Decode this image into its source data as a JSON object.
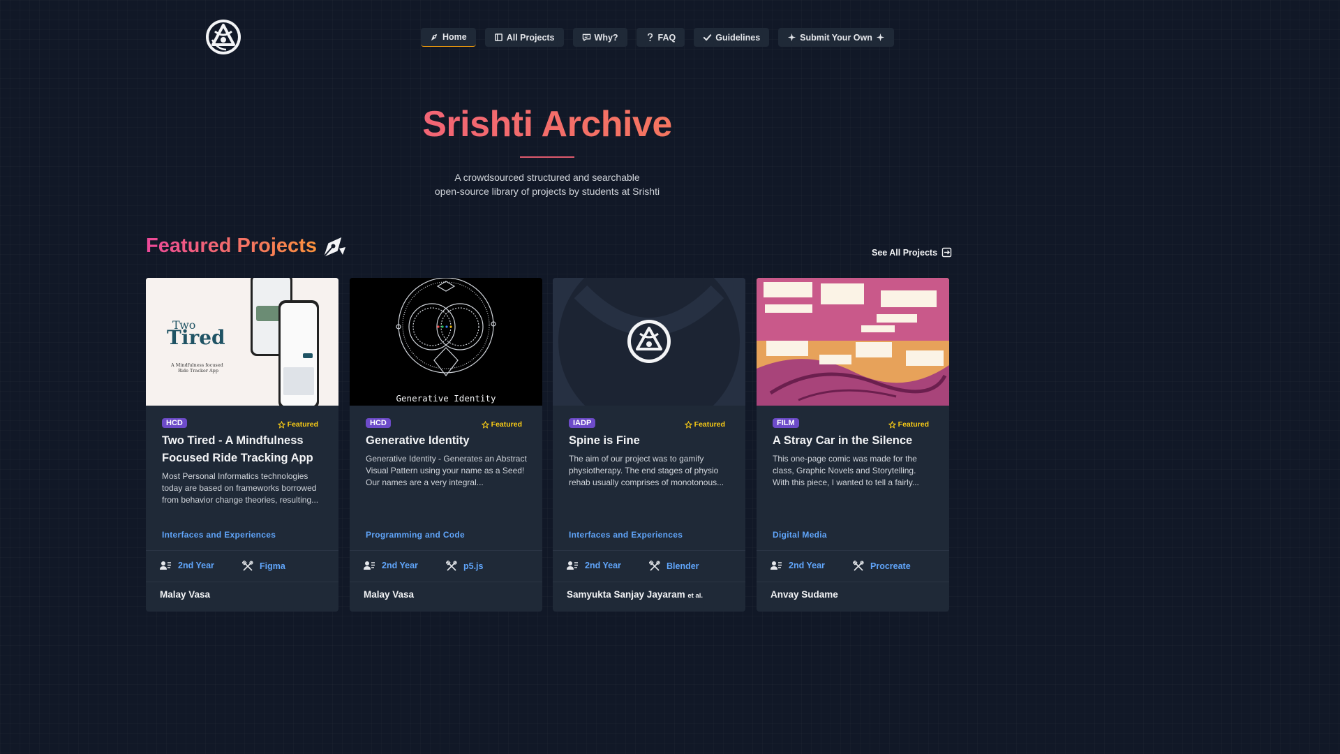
{
  "nav": {
    "items": [
      {
        "label": "Home",
        "icon": "pen-nib-icon"
      },
      {
        "label": "All Projects",
        "icon": "book-icon"
      },
      {
        "label": "Why?",
        "icon": "chat-icon"
      },
      {
        "label": "FAQ",
        "icon": "question-icon"
      },
      {
        "label": "Guidelines",
        "icon": "check-icon"
      },
      {
        "label": "Submit Your Own",
        "icon": "sparkle-icon"
      }
    ]
  },
  "hero": {
    "title": "Srishti Archive",
    "subtitle_line1": "A crowdsourced structured and searchable",
    "subtitle_line2": "open-source library of projects by students at Srishti"
  },
  "featured": {
    "title": "Featured Projects",
    "see_all_label": "See All Projects"
  },
  "cards": [
    {
      "tag": "HCD",
      "featured_label": "Featured",
      "title": "Two Tired - A Mindfulness Focused Ride Tracking App",
      "description": "Most Personal Informatics technologies today are based on frameworks borrowed from behavior change theories, resulting...",
      "category": "Interfaces and Experiences",
      "year": "2nd Year",
      "tool": "Figma",
      "author": "Malay Vasa",
      "author_suffix": "",
      "image_text": {
        "brand_small": "Two",
        "brand_big": "Tired",
        "tagline_1": "A Mindfulness focused",
        "tagline_2": "Ride Tracker App"
      }
    },
    {
      "tag": "HCD",
      "featured_label": "Featured",
      "title": "Generative Identity",
      "description": "Generative Identity - Generates an Abstract Visual Pattern using your name as a Seed! Our names are a very integral...",
      "category": "Programming and Code",
      "year": "2nd Year",
      "tool": "p5.js",
      "author": "Malay Vasa",
      "author_suffix": "",
      "image_text": {
        "caption": "Generative Identity"
      }
    },
    {
      "tag": "IADP",
      "featured_label": "Featured",
      "title": "Spine is Fine",
      "description": "The aim of our project was to gamify physiotherapy. The end stages of physio rehab usually comprises of monotonous...",
      "category": "Interfaces and Experiences",
      "year": "2nd Year",
      "tool": "Blender",
      "author": "Samyukta Sanjay Jayaram",
      "author_suffix": "et al."
    },
    {
      "tag": "FILM",
      "featured_label": "Featured",
      "title": "A Stray Car in the Silence",
      "description": "This one-page comic was made for the class, Graphic Novels and Storytelling. With this piece, I wanted to tell a fairly...",
      "category": "Digital Media",
      "year": "2nd Year",
      "tool": "Procreate",
      "author": "Anvay Sudame",
      "author_suffix": ""
    }
  ],
  "colors": {
    "background": "#111827",
    "card": "#1f2937",
    "accent_gradient_start": "#ec4899",
    "accent_gradient_end": "#fb923c",
    "tag": "#6d4bc9",
    "featured": "#facc15",
    "link": "#60a5fa"
  }
}
